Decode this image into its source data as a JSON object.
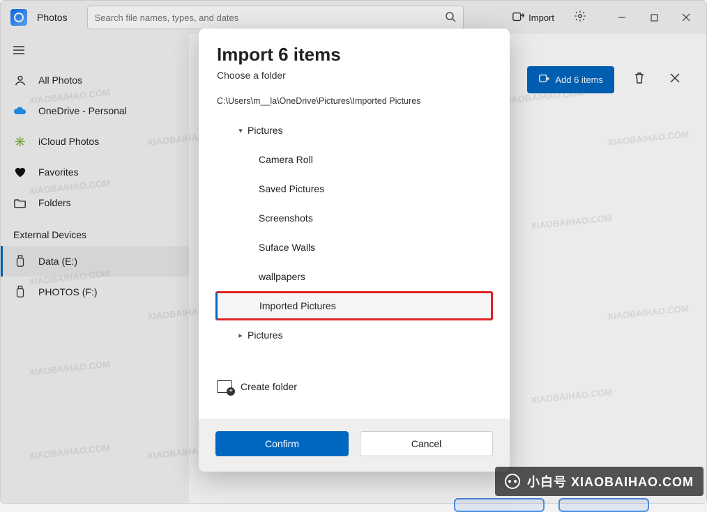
{
  "app": {
    "title": "Photos"
  },
  "search": {
    "placeholder": "Search file names, types, and dates"
  },
  "toolbar": {
    "import_label": "Import"
  },
  "sidebar": {
    "all_photos": "All Photos",
    "onedrive": "OneDrive - Personal",
    "icloud": "iCloud Photos",
    "favorites": "Favorites",
    "folders": "Folders",
    "external_header": "External Devices",
    "drive1": "Data (E:)",
    "drive2": "PHOTOS (F:)"
  },
  "actions": {
    "add_items": "Add 6 items"
  },
  "dialog": {
    "title": "Import 6 items",
    "subtitle": "Choose a folder",
    "path": "C:\\Users\\m__la\\OneDrive\\Pictures\\Imported Pictures",
    "tree": {
      "root": "Pictures",
      "children": [
        "Camera Roll",
        "Saved Pictures",
        "Screenshots",
        "Suface Walls",
        "wallpapers",
        "Imported Pictures"
      ],
      "sibling": "Pictures"
    },
    "create_folder": "Create folder",
    "confirm": "Confirm",
    "cancel": "Cancel"
  },
  "watermark": {
    "label": "小白号 XIAOBAIHAO.COM",
    "scatter": "XIAOBAIHAO.COM"
  }
}
